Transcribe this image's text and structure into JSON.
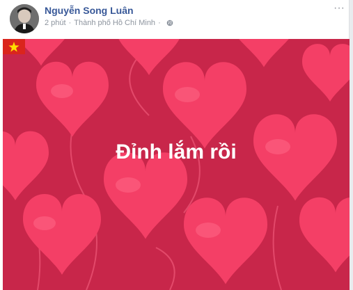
{
  "post": {
    "author": "Nguyễn Song Luân",
    "time": "2 phút",
    "separator": "·",
    "location": "Thành phố Hồ Chí Minh",
    "privacy_icon": "globe-icon",
    "more_icon": "more-icon",
    "more_label": "···"
  },
  "background": {
    "headline": "Đỉnh lắm rồi",
    "flag_icon": "vietnam-flag-icon",
    "colors": {
      "background": "#c8264a",
      "heart": "#f43f66",
      "heart_highlight": "#ff6b89",
      "text": "#ffffff",
      "flag_red": "#da251d",
      "flag_star": "#ffde00"
    }
  }
}
